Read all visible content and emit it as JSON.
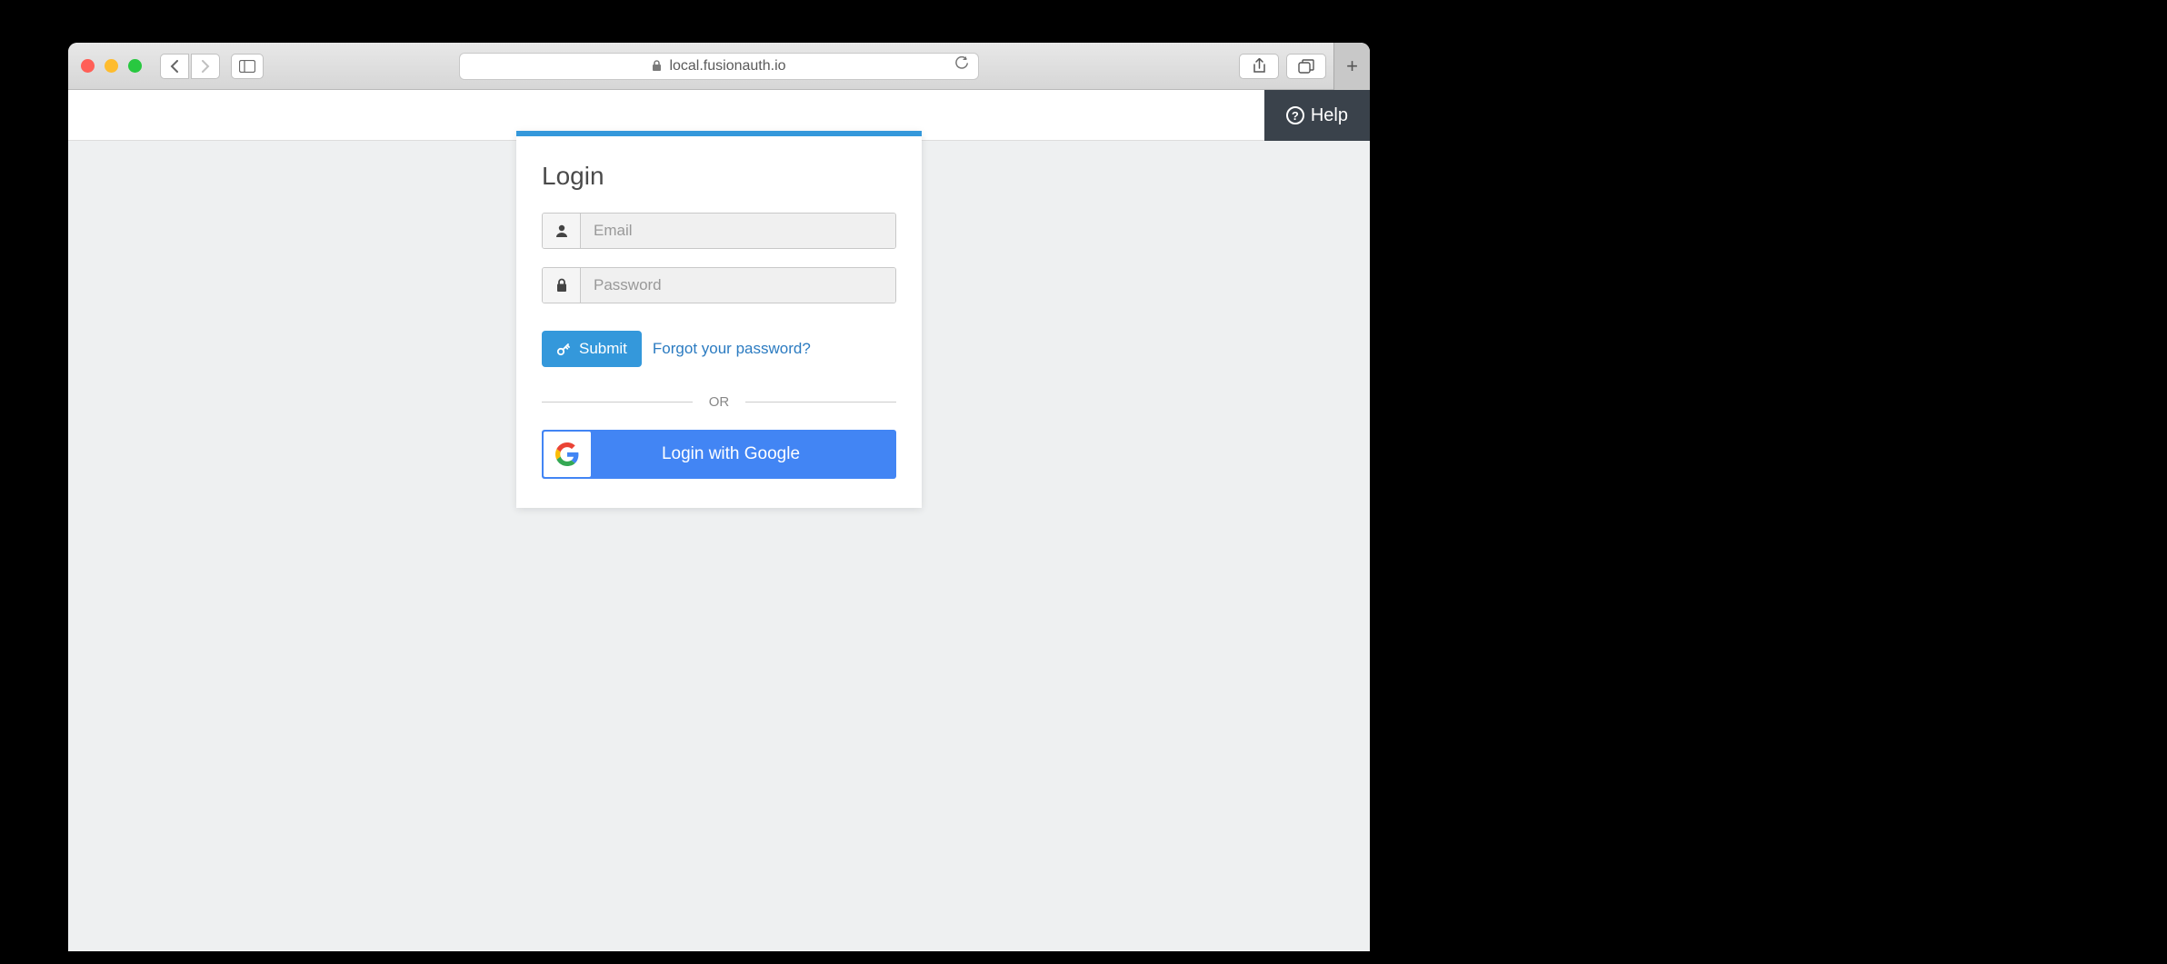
{
  "browser": {
    "url": "local.fusionauth.io"
  },
  "header": {
    "help_label": "Help"
  },
  "login": {
    "title": "Login",
    "email_placeholder": "Email",
    "password_placeholder": "Password",
    "submit_label": "Submit",
    "forgot_label": "Forgot your password?",
    "divider_label": "OR",
    "google_label": "Login with Google"
  }
}
